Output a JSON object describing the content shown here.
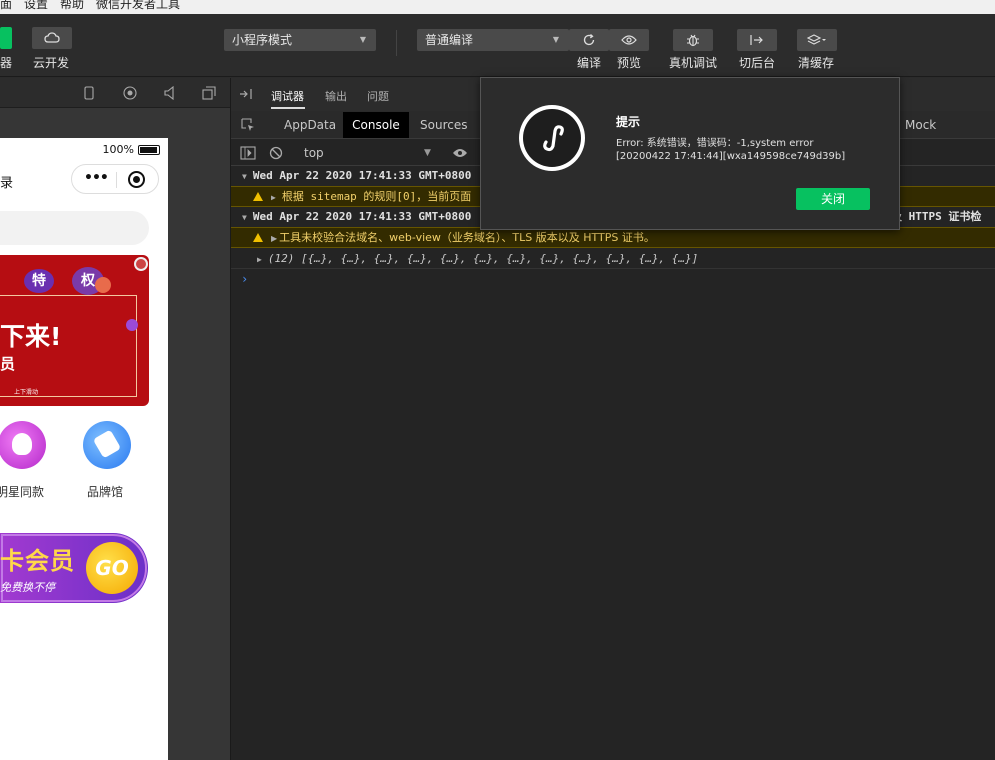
{
  "menubar": {
    "items": [
      "面",
      "设置",
      "帮助",
      "微信开发者工具"
    ]
  },
  "toolbar": {
    "left_labels": [
      "器",
      "云开发"
    ],
    "mode_select": "小程序模式",
    "compile_select": "普通编译",
    "actions": [
      "编译",
      "预览",
      "真机调试",
      "切后台",
      "清缓存"
    ]
  },
  "simulator": {
    "status_battery": "100%",
    "nav_char": "录",
    "banner": {
      "tag1": "特",
      "tag2": "权",
      "main": "下来!",
      "sub": "员",
      "small": "上下滑动"
    },
    "icons": [
      "明星同款",
      "品牌馆"
    ],
    "member": {
      "title": "卡会员",
      "sub": "免费换不停",
      "go": "GO"
    }
  },
  "debugger": {
    "top_tabs": [
      "调试器",
      "输出",
      "问题"
    ],
    "tabs": [
      "AppData",
      "Console",
      "Sources",
      "Mock"
    ],
    "context": "top",
    "logs": [
      {
        "type": "group",
        "text": "Wed Apr 22 2020 17:41:33 GMT+0800"
      },
      {
        "type": "warn",
        "text": "根据 sitemap 的规则[0]，当前页面"
      },
      {
        "type": "group",
        "text": "Wed Apr 22 2020 17:41:33 GMT+0800"
      },
      {
        "type": "warn",
        "text": "工具未校验合法域名、web-view（业务域名）、TLS 版本以及 HTTPS 证书。"
      },
      {
        "type": "array",
        "text": "(12) [{…}, {…}, {…}, {…}, {…}, {…}, {…}, {…}, {…}, {…}, {…}, {…}]"
      }
    ],
    "group2_suffix": "及 HTTPS 证书检"
  },
  "dialog": {
    "title": "提示",
    "message": "Error: 系统错误，错误码：-1,system error",
    "meta": "[20200422 17:41:44][wxa149598ce749d39b]",
    "close_label": "关闭"
  }
}
